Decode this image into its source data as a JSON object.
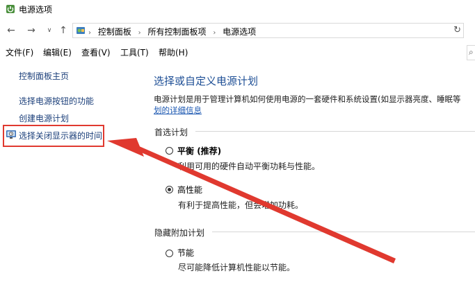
{
  "window": {
    "title": "电源选项"
  },
  "address": {
    "breadcrumbs": [
      "控制面板",
      "所有控制面板项",
      "电源选项"
    ]
  },
  "menu": [
    "文件(F)",
    "编辑(E)",
    "查看(V)",
    "工具(T)",
    "帮助(H)"
  ],
  "sidebar": {
    "items": [
      "控制面板主页",
      "选择电源按钮的功能",
      "创建电源计划",
      "选择关闭显示器的时间"
    ]
  },
  "main": {
    "title": "选择或自定义电源计划",
    "description": "电源计划是用于管理计算机如何使用电源的一套硬件和系统设置(如显示器亮度、睡眠等",
    "description_link": "划的详细信息",
    "preferred_label": "首选计划",
    "hidden_label": "隐藏附加计划",
    "plans": [
      {
        "name": "平衡",
        "tag": " (推荐)",
        "desc": "利用可用的硬件自动平衡功耗与性能。",
        "selected": false
      },
      {
        "name": "高性能",
        "tag": "",
        "desc": "有利于提高性能，但会增加功耗。",
        "selected": true
      },
      {
        "name": "节能",
        "tag": "",
        "desc": "尽可能降低计算机性能以节能。",
        "selected": false
      }
    ]
  },
  "colors": {
    "annotation": "#e0392f",
    "link": "#1b3f7a",
    "heading": "#1d4e95"
  }
}
